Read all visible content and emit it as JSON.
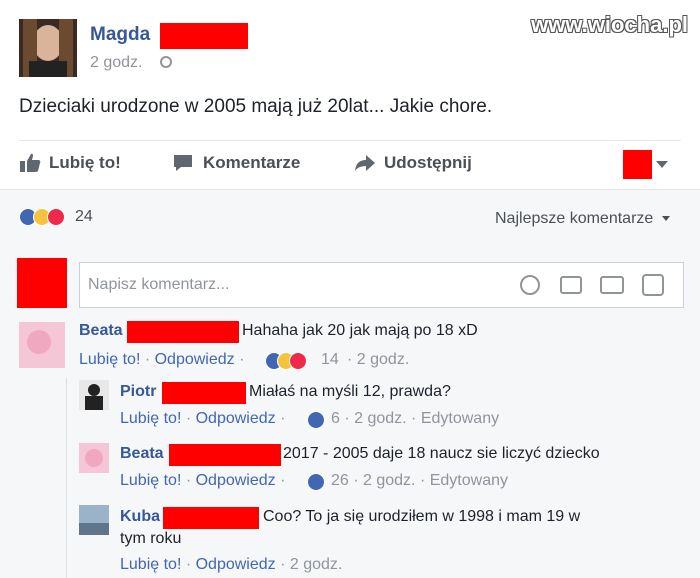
{
  "watermark": "www.wiocha.pl",
  "post": {
    "author": "Magda",
    "time": "2 godz.",
    "text": "Dzieciaki urodzone w 2005 mają już 20lat... Jakie chore."
  },
  "actions": {
    "like": "Lubię to!",
    "comment": "Komentarze",
    "share": "Udostępnij"
  },
  "reactions": {
    "count": "24",
    "sort_label": "Najlepsze komentarze"
  },
  "composer": {
    "placeholder": "Napisz komentarz..."
  },
  "comments": [
    {
      "author": "Beata",
      "text": "Hahaha jak 20 jak mają po 18 xD",
      "like": "Lubię to!",
      "reply": "Odpowiedz",
      "count": "14",
      "time": "2 godz."
    },
    {
      "author": "Piotr",
      "text": "Miałaś na myśli 12, prawda?",
      "like": "Lubię to!",
      "reply": "Odpowiedz",
      "count": "6",
      "time": "2 godz.",
      "edited": "Edytowany"
    },
    {
      "author": "Beata",
      "text": "2017 - 2005 daje 18 naucz sie liczyć dziecko",
      "like": "Lubię to!",
      "reply": "Odpowiedz",
      "count": "26",
      "time": "2 godz.",
      "edited": "Edytowany"
    },
    {
      "author": "Kuba",
      "text_line1": "Coo? To ja się urodziłem w 1998 i mam 19 w",
      "text_line2": "tym roku",
      "like": "Lubię to!",
      "reply": "Odpowiedz",
      "time": "2 godz."
    }
  ],
  "colors": {
    "fb_blue": "#365899",
    "link_blue": "#4267b2",
    "redaction": "#ff0000"
  }
}
